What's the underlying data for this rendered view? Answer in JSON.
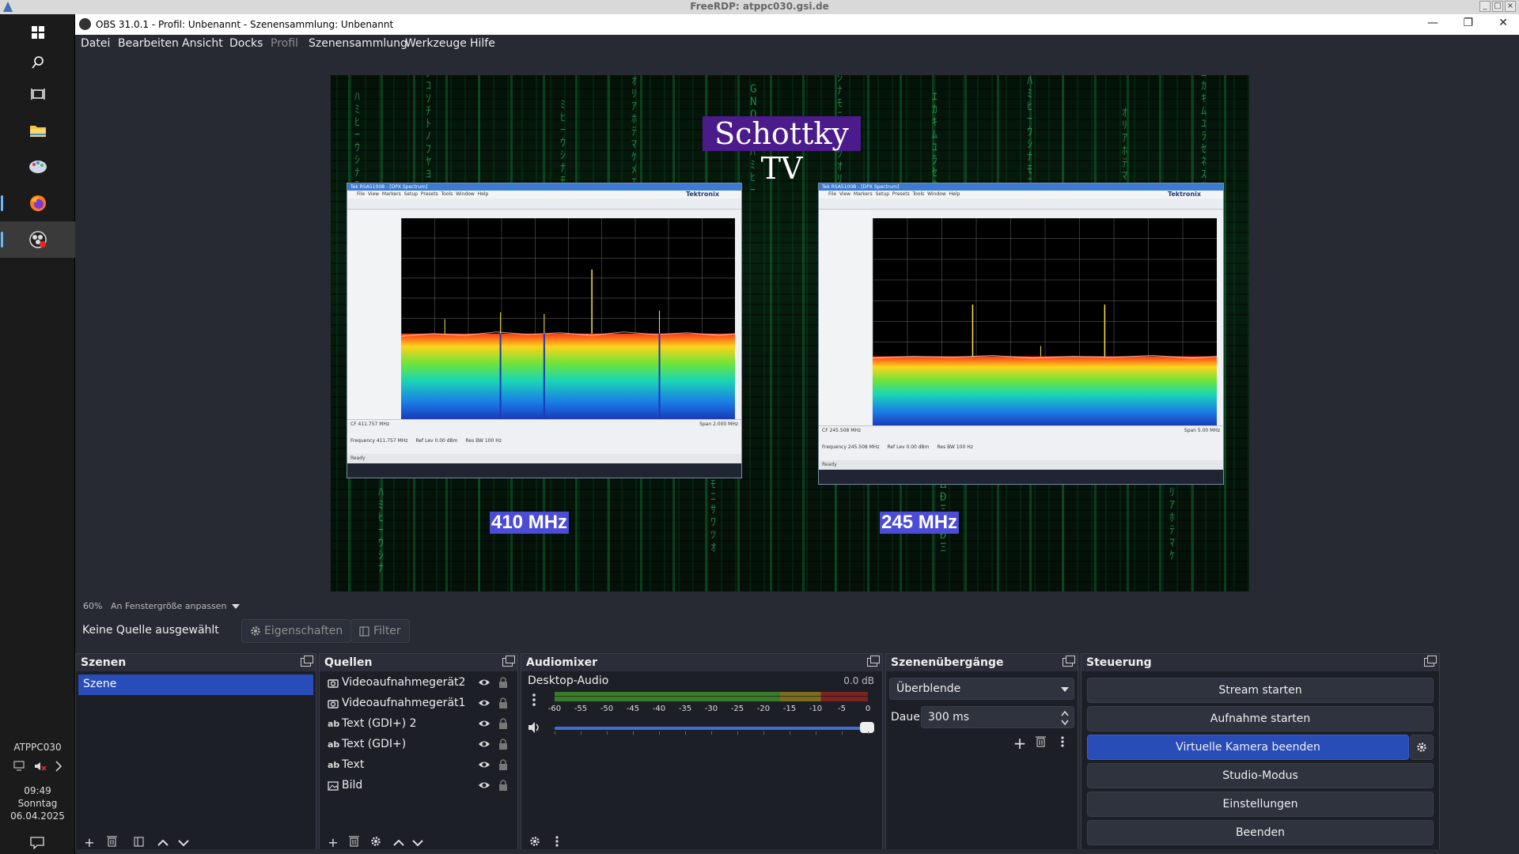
{
  "rdp": {
    "title": "FreeRDP: atppc030.gsi.de"
  },
  "taskbar": {
    "icons": [
      "windows-start-icon",
      "search-icon",
      "task-view-icon",
      "file-explorer-icon",
      "paint-app-icon",
      "firefox-icon",
      "obs-icon"
    ],
    "hostname": "ATPPC030",
    "time": "09:49",
    "weekday": "Sonntag",
    "date": "06.04.2025"
  },
  "window": {
    "title": "OBS 31.0.1 - Profil: Unbenannt - Szenensammlung: Unbenannt"
  },
  "menu": [
    "Datei",
    "Bearbeiten",
    "Ansicht",
    "Docks",
    "Profil",
    "Szenensammlung",
    "Werkzeuge",
    "Hilfe"
  ],
  "preview": {
    "title_text": "Schottky TV",
    "left_label": "410 MHz",
    "right_label": "245 MHz",
    "left_analyzer": {
      "window_title": "Tek RSA5100B - [DPX Spectrum]",
      "brand": "Tektronix",
      "center_freq": "CF 411.757 MHz",
      "span": "Span 2.000 MHz",
      "frequency_field": "411.757 MHz",
      "ref_lev": "0.00 dBm",
      "res_bw": "100 Hz"
    },
    "right_analyzer": {
      "window_title": "Tek RSA5100B - [DPX Spectrum]",
      "brand": "Tektronix",
      "center_freq": "CF 245.508 MHz",
      "span": "Span 5.00 MHz",
      "frequency_field": "245.508 MHz",
      "ref_lev": "0.00 dBm",
      "res_bw": "100 Hz"
    }
  },
  "zoom": {
    "level": "60%",
    "fit_label": "An Fenstergröße anpassen"
  },
  "source_bar": {
    "status": "Keine Quelle ausgewählt",
    "properties_label": "Eigenschaften",
    "filter_label": "Filter"
  },
  "scenes": {
    "title": "Szenen",
    "items": [
      "Szene"
    ]
  },
  "sources": {
    "title": "Quellen",
    "items": [
      {
        "name": "Videoaufnahmegerät2",
        "icon": "camera-icon"
      },
      {
        "name": "Videoaufnahmegerät1",
        "icon": "camera-icon"
      },
      {
        "name": "Text (GDI+) 2",
        "icon": "text-icon"
      },
      {
        "name": "Text (GDI+)",
        "icon": "text-icon"
      },
      {
        "name": "Text",
        "icon": "text-icon"
      },
      {
        "name": "Bild",
        "icon": "image-icon"
      }
    ]
  },
  "mixer": {
    "title": "Audiomixer",
    "track": "Desktop-Audio",
    "db": "0.0 dB",
    "ticks": [
      "-60",
      "-55",
      "-50",
      "-45",
      "-40",
      "-35",
      "-30",
      "-25",
      "-20",
      "-15",
      "-10",
      "-5",
      "0"
    ],
    "volume": 1.0
  },
  "transitions": {
    "title": "Szenenübergänge",
    "selected": "Überblende",
    "duration_label": "Dauer",
    "duration_value": "300 ms"
  },
  "controls": {
    "title": "Steuerung",
    "buttons": [
      "Stream starten",
      "Aufnahme starten",
      "Virtuelle Kamera beenden",
      "Studio-Modus",
      "Einstellungen",
      "Beenden"
    ]
  },
  "colors": {
    "accent": "#284cb8",
    "panel_bg": "#1d1f26",
    "window_bg": "#272a33",
    "title_highlight": "#4b1a8b",
    "label_highlight": "#4c4cd6"
  }
}
